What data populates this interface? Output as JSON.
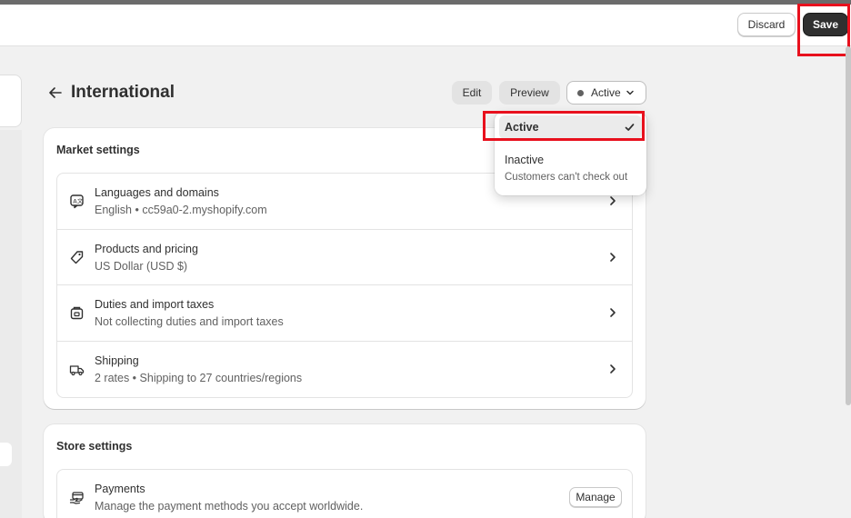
{
  "toolbar": {
    "discard_label": "Discard",
    "save_label": "Save"
  },
  "header": {
    "title": "International",
    "edit_label": "Edit",
    "preview_label": "Preview",
    "status_label": "Active"
  },
  "status_menu": {
    "active_label": "Active",
    "inactive_label": "Inactive",
    "inactive_desc": "Customers can't check out"
  },
  "market_settings": {
    "title": "Market settings",
    "items": [
      {
        "title": "Languages and domains",
        "subtitle": "English • cc59a0-2.myshopify.com",
        "icon": "language-icon"
      },
      {
        "title": "Products and pricing",
        "subtitle": "US Dollar (USD $)",
        "icon": "price-tag-icon"
      },
      {
        "title": "Duties and import taxes",
        "subtitle": "Not collecting duties and import taxes",
        "icon": "package-icon"
      },
      {
        "title": "Shipping",
        "subtitle": "2 rates • Shipping to 27 countries/regions",
        "icon": "truck-icon"
      }
    ]
  },
  "store_settings": {
    "title": "Store settings",
    "items": [
      {
        "title": "Payments",
        "subtitle": "Manage the payment methods you accept worldwide.",
        "icon": "payment-icon",
        "action_label": "Manage"
      }
    ]
  },
  "colors": {
    "accent_dark": "#303030",
    "highlight": "#e8101d",
    "background": "#f1f1f1"
  }
}
